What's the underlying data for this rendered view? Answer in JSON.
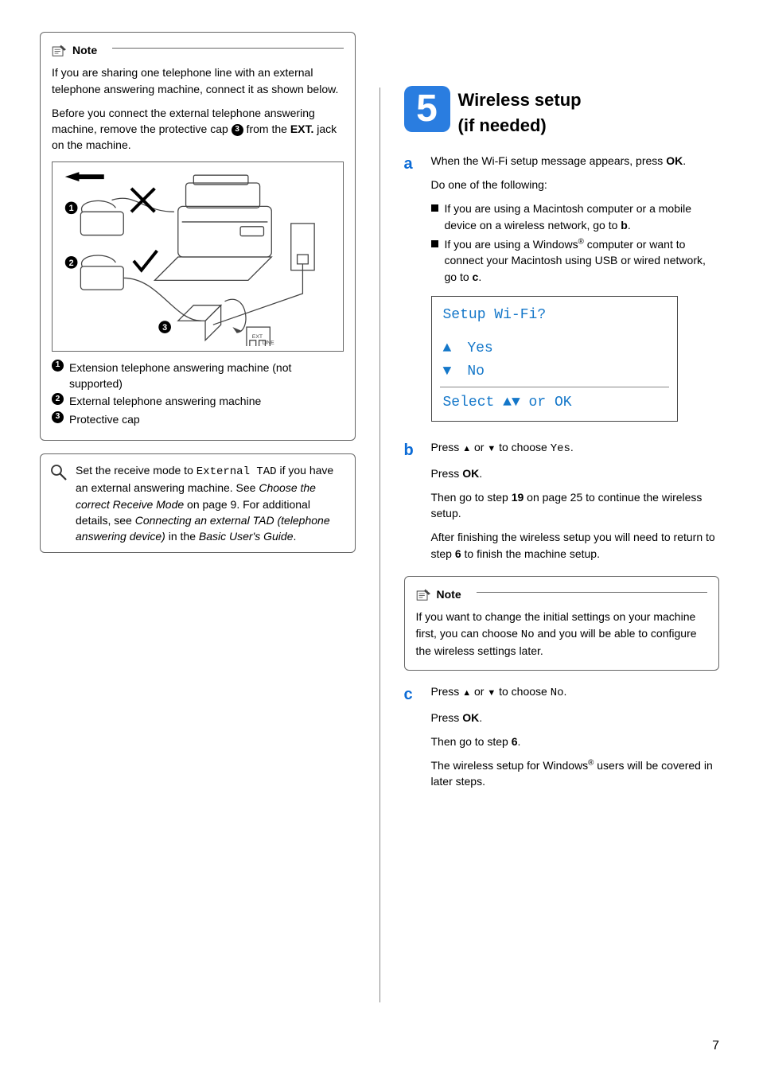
{
  "left": {
    "note": {
      "title": "Note",
      "p1a": "If you are sharing one telephone line with an external telephone answering machine, connect it as shown below.",
      "p2a": "Before you connect the external telephone answering machine, remove the protective cap ",
      "p2b": " from the ",
      "p2_ext": "EXT.",
      "p2c": " jack on the machine.",
      "legend1": "Extension telephone answering machine (not supported)",
      "legend2": "External telephone answering machine",
      "legend3": "Protective cap"
    },
    "tip": {
      "t1": "Set the receive mode to ",
      "t_mono": "External TAD",
      "t2": " if you have an external answering machine. See ",
      "t_italic1": "Choose the correct Receive Mode",
      "t3": " on page 9. For additional details, see ",
      "t_italic2": "Connecting an external TAD (telephone answering device)",
      "t4": " in the ",
      "t_italic3": "Basic User's Guide",
      "t5": "."
    }
  },
  "right": {
    "num": "5",
    "title1": "Wireless setup",
    "title2": "(if needed)",
    "a": {
      "p1a": "When the Wi-Fi setup message appears, press ",
      "p1_ok": "OK",
      "p1b": ".",
      "p2": "Do one of the following:",
      "b1a": "If you are using a Macintosh computer or a mobile device on a wireless network, go to ",
      "b1_ref": "b",
      "b1b": ".",
      "b2a": "If you are using a Windows",
      "b2_reg": "®",
      "b2b": " computer or want to connect your Macintosh using USB or wired network, go to ",
      "b2_ref": "c",
      "b2c": "."
    },
    "lcd": {
      "line1": "Setup Wi-Fi?",
      "opt1": "Yes",
      "opt2": "No",
      "footer_a": "Select ",
      "footer_b": " or OK"
    },
    "b": {
      "p1a": "Press ",
      "p1b": " or ",
      "p1c": " to choose ",
      "p1_mono": "Yes",
      "p1d": ".",
      "p2a": "Press ",
      "p2_ok": "OK",
      "p2b": ".",
      "p3a": "Then go to step ",
      "p3_num": "19",
      "p3b": " on page 25 to continue the wireless setup.",
      "p4a": "After finishing the wireless setup you will need to return to step ",
      "p4_num": "6",
      "p4b": " to finish the machine setup."
    },
    "note": {
      "title": "Note",
      "body_a": "If you want to change the initial settings on your machine first, you can choose ",
      "body_mono": "No",
      "body_b": " and you will be able to configure the wireless settings later."
    },
    "c": {
      "p1a": "Press ",
      "p1b": " or ",
      "p1c": " to choose ",
      "p1_mono": "No",
      "p1d": ".",
      "p2a": "Press ",
      "p2_ok": "OK",
      "p2b": ".",
      "p3a": "Then go to step ",
      "p3_num": "6",
      "p3b": ".",
      "p4a": "The wireless setup for Windows",
      "p4_reg": "®",
      "p4b": " users will be covered in later steps."
    }
  },
  "page_number": "7",
  "letters": {
    "a": "a",
    "b": "b",
    "c": "c"
  },
  "circled": {
    "one": "1",
    "two": "2",
    "three": "3"
  }
}
